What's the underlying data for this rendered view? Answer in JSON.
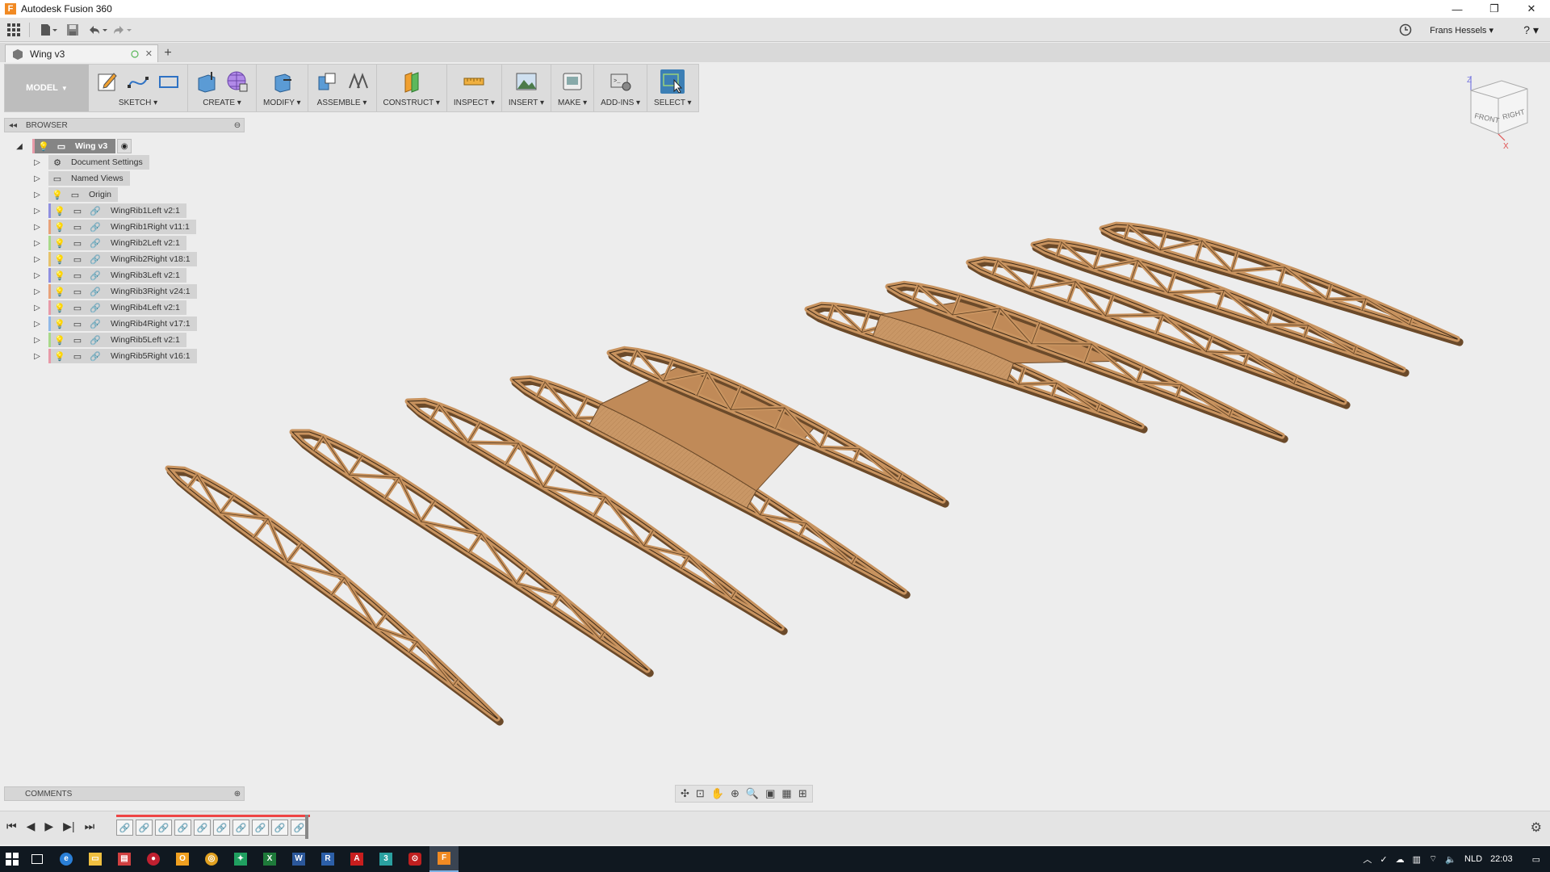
{
  "window": {
    "title": "Autodesk Fusion 360",
    "min": "—",
    "restore": "❐",
    "close": "✕"
  },
  "qat": {
    "user_name": "Frans Hessels ▾",
    "help": "? ▾"
  },
  "document_tab": {
    "name": "Wing v3",
    "close": "✕",
    "new_tab": "+"
  },
  "toolbar": {
    "workspace": "MODEL",
    "groups": [
      {
        "label": "SKETCH ▾"
      },
      {
        "label": "CREATE ▾"
      },
      {
        "label": "MODIFY ▾"
      },
      {
        "label": "ASSEMBLE ▾"
      },
      {
        "label": "CONSTRUCT ▾"
      },
      {
        "label": "INSPECT ▾"
      },
      {
        "label": "INSERT ▾"
      },
      {
        "label": "MAKE ▾"
      },
      {
        "label": "ADD-INS ▾"
      },
      {
        "label": "SELECT ▾"
      }
    ]
  },
  "browser": {
    "header": "BROWSER",
    "root": "Wing v3",
    "folders": [
      "Document Settings",
      "Named Views",
      "Origin"
    ],
    "components": [
      {
        "name": "WingRib1Left v2:1",
        "color": "#8f8fe0"
      },
      {
        "name": "WingRib1Right v11:1",
        "color": "#e8a27a"
      },
      {
        "name": "WingRib2Left v2:1",
        "color": "#a8d98a"
      },
      {
        "name": "WingRib2Right v18:1",
        "color": "#e6c36b"
      },
      {
        "name": "WingRib3Left v2:1",
        "color": "#8f8fe0"
      },
      {
        "name": "WingRib3Right v24:1",
        "color": "#e8a27a"
      },
      {
        "name": "WingRib4Left v2:1",
        "color": "#e89aa8"
      },
      {
        "name": "WingRib4Right v17:1",
        "color": "#8fb8e8"
      },
      {
        "name": "WingRib5Left v2:1",
        "color": "#a8d98a"
      },
      {
        "name": "WingRib5Right v16:1",
        "color": "#e89aa8"
      }
    ]
  },
  "viewcube": {
    "front": "FRONT",
    "right": "RIGHT",
    "z": "Z",
    "x": "X"
  },
  "comments": {
    "header": "COMMENTS"
  },
  "timeline": {
    "feature_count": 10
  },
  "taskbar": {
    "lang": "NLD",
    "time": "22:03"
  },
  "colors": {
    "wood": "#c8935f",
    "wood_dark": "#6b4a2a",
    "accent": "#3c7fb5"
  }
}
